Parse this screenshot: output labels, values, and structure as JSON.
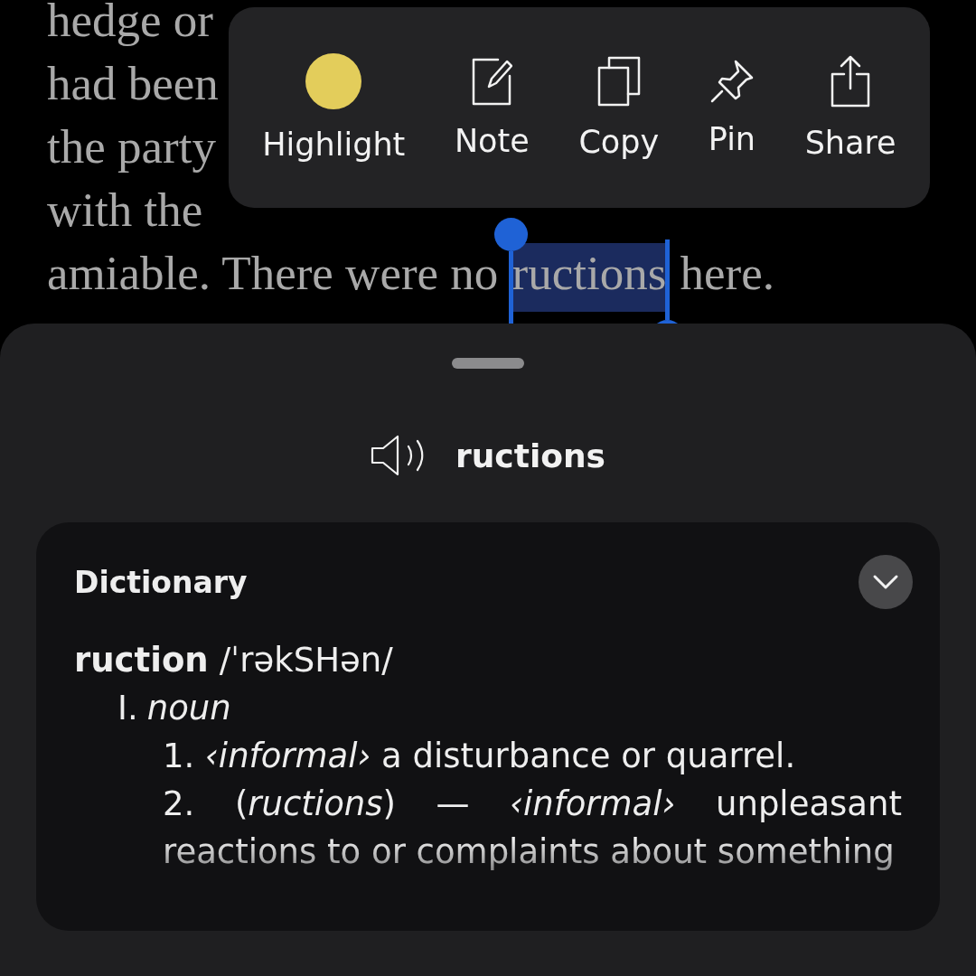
{
  "book": {
    "lines": [
      {
        "segments": [
          {
            "text": "hedge or",
            "selected": false
          }
        ]
      },
      {
        "segments": [
          {
            "text": "had been",
            "selected": false
          }
        ]
      },
      {
        "segments": [
          {
            "text": "the party",
            "selected": false
          }
        ]
      },
      {
        "segments": [
          {
            "text": "with the",
            "selected": false
          }
        ]
      },
      {
        "segments": [
          {
            "text": "amiable. There were no ",
            "selected": false
          },
          {
            "text": "ructions",
            "selected": true
          },
          {
            "text": " here.",
            "selected": false
          }
        ]
      }
    ]
  },
  "toolbar": {
    "actions": [
      {
        "kind": "highlight",
        "label": "Highlight",
        "color": "#e3cd5b"
      },
      {
        "kind": "note",
        "label": "Note"
      },
      {
        "kind": "copy",
        "label": "Copy"
      },
      {
        "kind": "pin",
        "label": "Pin"
      },
      {
        "kind": "share",
        "label": "Share"
      }
    ]
  },
  "sheet": {
    "word": "ructions",
    "dictionary": {
      "title": "Dictionary",
      "headword": "ruction",
      "pronunciation": "/ˈrəkSHən/",
      "pos_number": "I.",
      "pos": "*noun*",
      "senses": [
        {
          "number": "1.",
          "text": "*‹informal›* a disturbance or quarrel."
        },
        {
          "number": "2.",
          "text": "(*ructions*) — *‹informal›* unpleasant reactions to or complaints about something"
        }
      ]
    }
  }
}
